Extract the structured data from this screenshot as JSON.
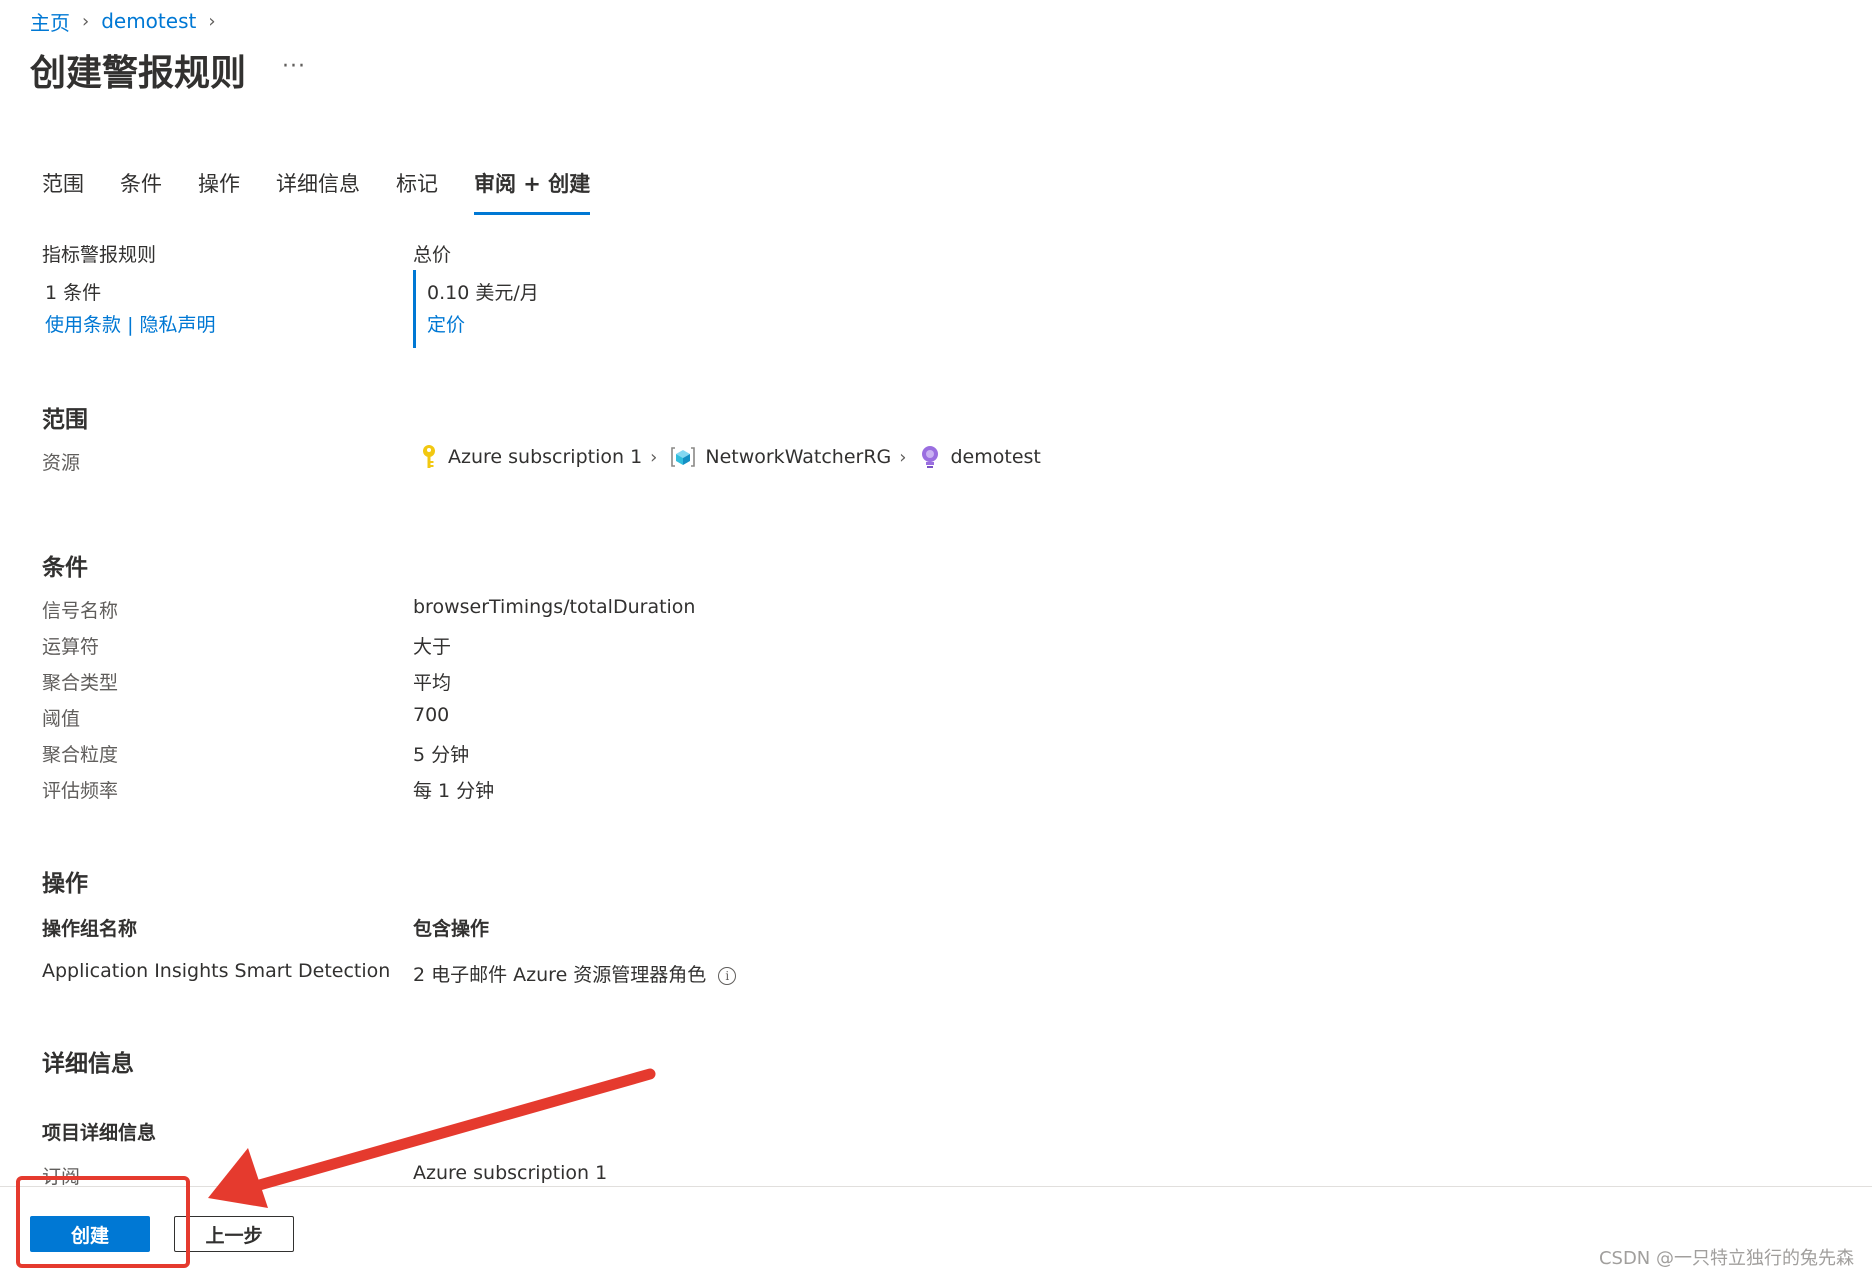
{
  "breadcrumb": {
    "home": "主页",
    "resource": "demotest"
  },
  "title": "创建警报规则",
  "more": "···",
  "tabs": [
    "范围",
    "条件",
    "操作",
    "详细信息",
    "标记",
    "审阅 + 创建"
  ],
  "active_tab": "审阅 + 创建",
  "summary": {
    "rule_type": "指标警报规则",
    "conditions_count": "1 条件",
    "terms_link": "使用条款",
    "divider": "|",
    "privacy_link": "隐私声明",
    "price_label": "总价",
    "price_value": "0.10 美元/月",
    "pricing_link": "定价"
  },
  "scope": {
    "heading": "范围",
    "resource_label": "资源",
    "path": [
      "Azure subscription 1",
      "NetworkWatcherRG",
      "demotest"
    ]
  },
  "condition": {
    "heading": "条件",
    "rows": [
      {
        "label": "信号名称",
        "value": "browserTimings/totalDuration"
      },
      {
        "label": "运算符",
        "value": "大于"
      },
      {
        "label": "聚合类型",
        "value": "平均"
      },
      {
        "label": "阈值",
        "value": "700"
      },
      {
        "label": "聚合粒度",
        "value": "5 分钟"
      },
      {
        "label": "评估频率",
        "value": "每 1 分钟"
      }
    ]
  },
  "actions": {
    "heading": "操作",
    "col_group": "操作组名称",
    "col_included": "包含操作",
    "group_name": "Application Insights Smart Detection",
    "included": "2 电子邮件 Azure 资源管理器角色",
    "info_glyph": "i"
  },
  "details": {
    "heading": "详细信息",
    "project_heading": "项目详细信息",
    "subscription_label": "订阅",
    "subscription_value": "Azure subscription 1"
  },
  "footer": {
    "create": "创建",
    "previous": "上一步"
  },
  "watermark": "CSDN @一只特立独行的兔先森",
  "colors": {
    "accent": "#0078d4",
    "annotation": "#e53a2e"
  }
}
